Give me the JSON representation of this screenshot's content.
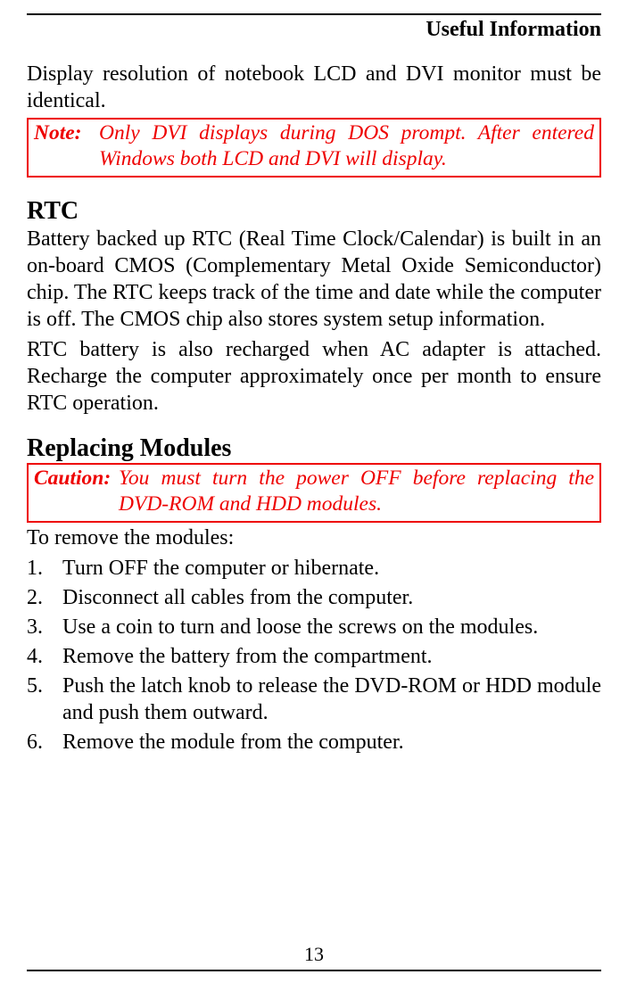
{
  "header": {
    "title": "Useful Information"
  },
  "intro_para": "Display resolution of notebook LCD and DVI monitor must be identical.",
  "note1": {
    "label": "Note:",
    "text": "Only DVI displays during DOS prompt. After entered Windows both LCD and DVI will display."
  },
  "rtc": {
    "heading": "RTC",
    "para1": "Battery backed up RTC (Real Time Clock/Calendar) is built in an on-board CMOS (Complementary Metal Oxide Semiconductor) chip. The RTC keeps track of the time and date while the computer is off. The CMOS chip also stores system setup information.",
    "para2": "RTC battery is also recharged when AC adapter is attached. Recharge the computer approximately once per month to ensure RTC operation."
  },
  "replacing": {
    "heading": "Replacing Modules",
    "caution_label": "Caution:",
    "caution_text": "You must turn the power OFF before replacing the DVD-ROM and HDD modules.",
    "lead": "To remove the modules:",
    "steps": [
      "Turn OFF the computer or hibernate.",
      "Disconnect all cables from the computer.",
      "Use a coin to turn and loose the screws on the modules.",
      "Remove the battery from the compartment.",
      "Push the latch knob to release the DVD-ROM or HDD module and push them outward.",
      "Remove the module from the computer."
    ]
  },
  "footer": {
    "page_number": "13"
  }
}
